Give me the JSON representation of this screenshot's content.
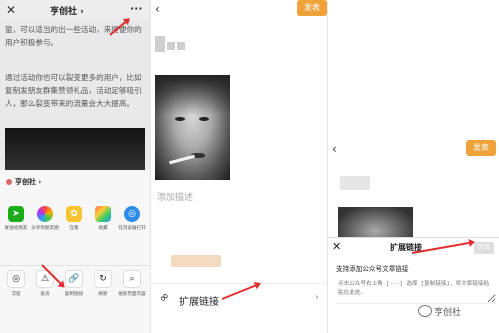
{
  "panel1": {
    "close_icon": "close-icon",
    "title": "亨创社",
    "more_icon": "more-dots-icon",
    "article_lines": [
      "跫，可以适当的出一些活动，来提便你的",
      "用户积极参与。",
      "",
      "通过活动你也可以裂变更多的用户，比如",
      "复制发朋友群集赞领礼品，活动足够吸引",
      "人，那么裂变带来的流量会大大提高。"
    ],
    "sheet_account": "亨创社",
    "share_row": [
      {
        "icon": "share-friend-icon",
        "label": "发送给朋友"
      },
      {
        "icon": "moments-icon",
        "label": "分享到朋友圈"
      },
      {
        "icon": "look-icon",
        "label": "在看"
      },
      {
        "icon": "collect-icon",
        "label": "收藏"
      },
      {
        "icon": "browser-icon",
        "label": "在浏览器打开"
      }
    ],
    "action_row": [
      {
        "icon": "float-window-icon",
        "label": "浮窗"
      },
      {
        "icon": "complain-icon",
        "label": "投诉"
      },
      {
        "icon": "copy-link-icon",
        "label": "复制链接"
      },
      {
        "icon": "refresh-icon",
        "label": "刷新"
      },
      {
        "icon": "search-page-icon",
        "label": "搜索页面内容"
      }
    ]
  },
  "panel2": {
    "back_icon": "back-icon",
    "publish": "发表",
    "add_description": "添加描述",
    "extend_link_label": "扩展链接",
    "link_icon": "link-icon"
  },
  "panel3": {
    "publish": "发表",
    "dialog_title": "扩展链接",
    "dialog_ok": "完成",
    "dialog_subtitle": "支持添加公众号文章链接",
    "dialog_placeholder": "点击公众号右上角 [···] 选择 [复制链接]，将文章链接粘贴在此处。"
  },
  "watermark": "亨创社",
  "colors": {
    "accent_orange": "#f0a23a",
    "annotation_red": "#e03030"
  }
}
